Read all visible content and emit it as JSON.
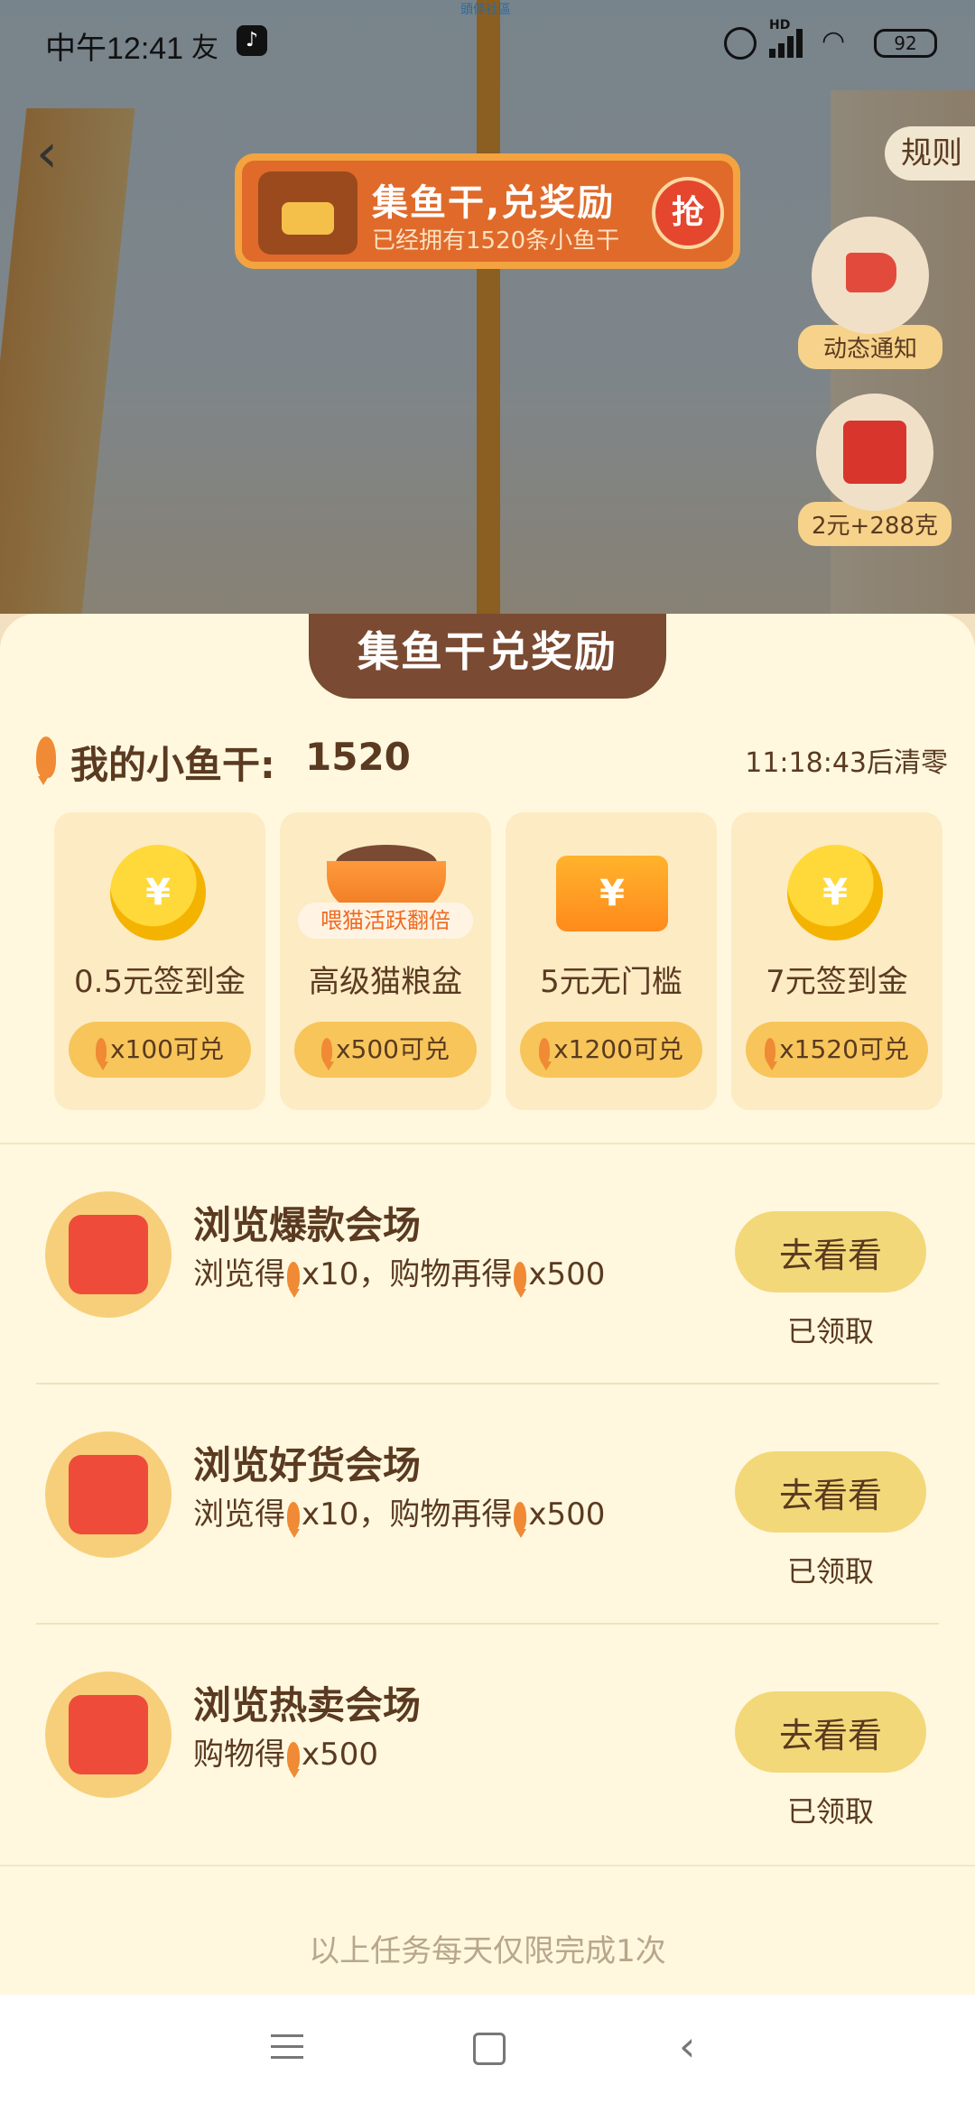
{
  "status_bar": {
    "time": "中午12:41",
    "center_text": "頭條社區",
    "battery": "92",
    "hd": "HD"
  },
  "page": {
    "back_icon": "chevron-left-icon",
    "rules_label": "规则"
  },
  "banner": {
    "title": "集鱼干,兑奖励",
    "subtitle": "已经拥有1520条小鱼干",
    "grab_label": "抢"
  },
  "side": {
    "notice_label": "动态通知",
    "redpack_label": "2元+288克"
  },
  "sheet": {
    "title": "集鱼干兑奖励",
    "balance_label": "我的小鱼干:",
    "balance_value": "1520",
    "reset_text": "11:18:43后清零"
  },
  "rewards": [
    {
      "name": "0.5元签到金",
      "icon": "coin-icon",
      "price": "x100可兑"
    },
    {
      "name": "高级猫粮盆",
      "icon": "cat-food-bowl-icon",
      "tag": "喂猫活跃翻倍",
      "price": "x500可兑"
    },
    {
      "name": "5元无门槛",
      "icon": "coupon-icon",
      "price": "x1200可兑"
    },
    {
      "name": "7元签到金",
      "icon": "coin-icon",
      "price": "x1520可兑"
    }
  ],
  "currency_symbol": "¥",
  "tasks": [
    {
      "title": "浏览爆款会场",
      "icon": "shopping-bag-icon",
      "desc_prefix": "浏览得",
      "desc_a": "x10，购物再得",
      "desc_b": "x500",
      "button": "去看看",
      "status": "已领取"
    },
    {
      "title": "浏览好货会场",
      "icon": "gift-box-icon",
      "desc_prefix": "浏览得",
      "desc_a": "x10，购物再得",
      "desc_b": "x500",
      "button": "去看看",
      "status": "已领取"
    },
    {
      "title": "浏览热卖会场",
      "icon": "storefront-icon",
      "desc_prefix": "购物得",
      "desc_a": "x500",
      "desc_b": "",
      "button": "去看看",
      "status": "已领取"
    }
  ],
  "footer_note": "以上任务每天仅限完成1次",
  "colors": {
    "sheet_bg": "#fff8df",
    "title_pill": "#7a4a32",
    "button": "#f3d87a",
    "text_brown": "#5a3a20",
    "banner": "#e06a2a"
  }
}
